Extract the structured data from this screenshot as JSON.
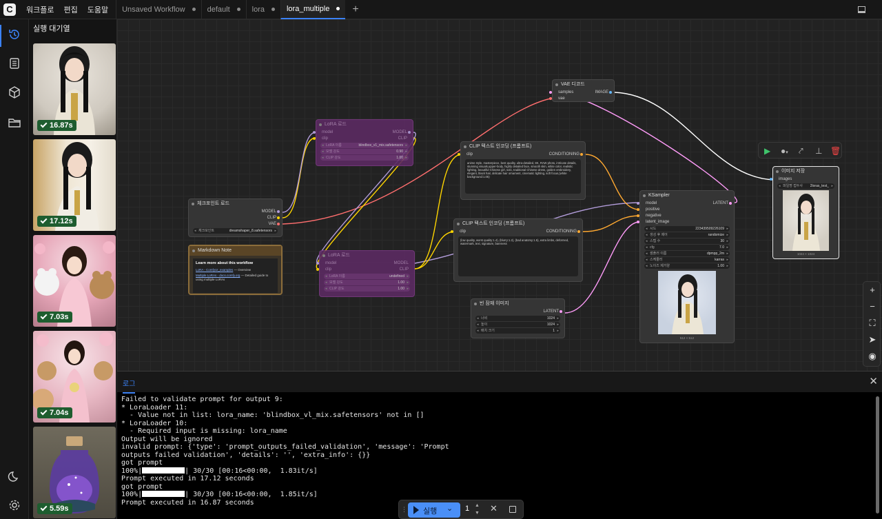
{
  "topbar": {
    "menus": [
      "워크플로",
      "편집",
      "도움말"
    ],
    "tabs": [
      {
        "label": "Unsaved Workflow",
        "active": false
      },
      {
        "label": "default",
        "active": false
      },
      {
        "label": "lora",
        "active": false
      },
      {
        "label": "lora_multiple",
        "active": true
      }
    ],
    "new_tab": "+"
  },
  "queue": {
    "title": "실행 대기열",
    "items": [
      {
        "time": "16.87s"
      },
      {
        "time": "17.12s"
      },
      {
        "time": "7.03s"
      },
      {
        "time": "7.04s"
      },
      {
        "time": "5.59s"
      }
    ]
  },
  "nodes": {
    "lora1": {
      "title": "LoRA 로드",
      "out_model": "MODEL",
      "out_clip": "CLIP",
      "in_model": "model",
      "in_clip": "clip",
      "w_name": "LoRA 이름",
      "w_name_val": "blindbox_v1_mix.safetensors",
      "w_model": "모델 강도",
      "w_model_val": "0.90",
      "w_clip": "CLIP 강도",
      "w_clip_val": "1.00"
    },
    "lora2": {
      "title": "LoRA 로드",
      "out_model": "MODEL",
      "out_clip": "CLIP",
      "in_model": "model",
      "in_clip": "clip",
      "w_name": "LoRA 이름",
      "w_name_val": "undefined",
      "w_model": "모델 강도",
      "w_model_val": "1.00",
      "w_clip": "CLIP 강도",
      "w_clip_val": "1.00"
    },
    "checkpoint": {
      "title": "체크포인트 로드",
      "out_model": "MODEL",
      "out_clip": "CLIP",
      "out_vae": "VAE",
      "w_ckpt": "체크포인트",
      "w_ckpt_val": "dreamshaper_8.safetensors"
    },
    "note": {
      "title": "Markdown Note",
      "heading": "Learn more about this workflow",
      "link1": "LoRA - ComfyUI_examples",
      "link1_suffix": " — Overview",
      "link2": "Multiple LoRAs - docs.comfy.org",
      "link2_suffix": " — Detailed guide to using multiple LoRAs"
    },
    "clip_pos": {
      "title": "CLIP 텍스트 인코딩 (프롬프트)",
      "in_clip": "clip",
      "out": "CONDITIONING",
      "text": "anime style, masterpiece, best quality, ultra-detailed, 8K, RAW photo, intricate details, stunning visuals,upper-body, highly detailed face, smooth skin, white color, realistic lighting, beautiful Chinese girl, solo, traditional Chinese dress, golden embroidery, elegant, black hair, delicate hair ornament, cinematic lighting, soft focus,(white background:1.05)"
    },
    "clip_neg": {
      "title": "CLIP 텍스트 인코딩 (프롬프트)",
      "in_clip": "clip",
      "out": "CONDITIONING",
      "text": "(low quality, worst quality:1.4), (blurry:1.2), (bad anatomy:1.5), extra limbs, deformed, watermark, text, signature, bareness"
    },
    "vae": {
      "title": "VAE 디코드",
      "in_samples": "samples",
      "in_vae": "vae",
      "out": "IMAGE"
    },
    "ksampler": {
      "title": "KSampler",
      "in_model": "model",
      "in_pos": "positive",
      "in_neg": "negative",
      "in_latent": "latent_image",
      "out": "LATENT",
      "w_seed": "시드",
      "w_seed_val": "223439509226109",
      "w_ctrl": "생성 후 제어",
      "w_ctrl_val": "randomize",
      "w_steps": "스텝 수",
      "w_steps_val": "30",
      "w_cfg": "cfg",
      "w_cfg_val": "7.0",
      "w_sampler": "샘플러 이름",
      "w_sampler_val": "dpmpp_2m",
      "w_sched": "스케줄러",
      "w_sched_val": "karras",
      "w_denoise": "노이즈 제거양",
      "w_denoise_val": "1.00",
      "dims": "512 × 512"
    },
    "empty": {
      "title": "빈 잠재 이미지",
      "out": "LATENT",
      "w_w": "너비",
      "w_w_val": "1024",
      "w_h": "높이",
      "w_h_val": "1024",
      "w_b": "배치 크기",
      "w_b_val": "1"
    },
    "save": {
      "title": "이미지 저장",
      "in_images": "images",
      "w_prefix": "파일명 접두사",
      "w_prefix_val": "2loras_test_",
      "dims": "1024 × 1024"
    }
  },
  "log": {
    "tab": "로그",
    "lines": [
      "Failed to validate prompt for output 9:",
      "* LoraLoader 11:",
      "  - Value not in list: lora_name: 'blindbox_vl_mix.safetensors' not in []",
      "* LoraLoader 10:",
      "  - Required input is missing: lora_name",
      "Output will be ignored",
      "invalid prompt: {'type': 'prompt_outputs_failed_validation', 'message': 'Prompt",
      "outputs failed validation', 'details': '', 'extra_info': {}}",
      "got prompt"
    ],
    "progress1_pre": "100%|",
    "progress1_post": "| 30/30 [00:16<00:00,  1.83it/s]",
    "line_exec1": "Prompt executed in 17.12 seconds",
    "line_got2": "got prompt",
    "progress2_pre": "100%|",
    "progress2_post": "| 30/30 [00:16<00:00,  1.85it/s]",
    "line_exec2": "Prompt executed in 16.87 seconds"
  },
  "runbar": {
    "label": "실행",
    "count": "1"
  }
}
